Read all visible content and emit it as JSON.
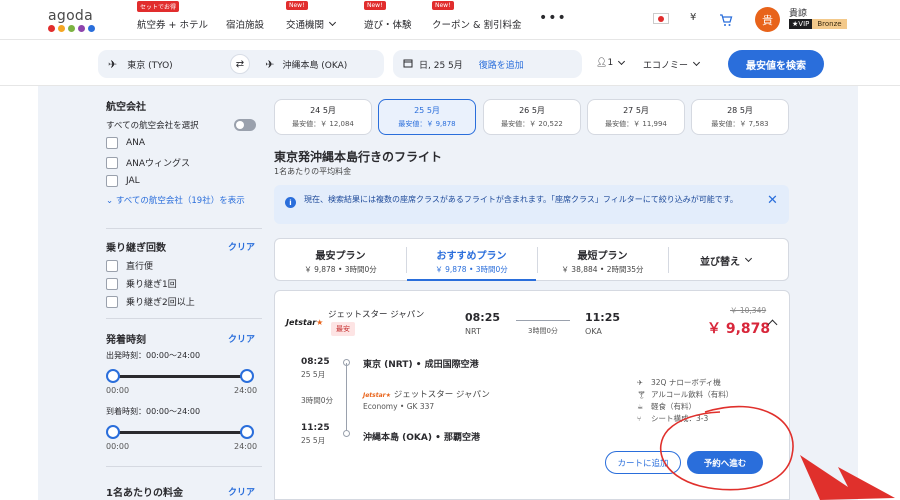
{
  "header": {
    "logo_text": "agoda",
    "nav": [
      {
        "label": "航空券 + ホテル",
        "badge": "セットでお得"
      },
      {
        "label": "宿泊施設",
        "badge": ""
      },
      {
        "label": "交通機関",
        "badge": "New!"
      },
      {
        "label": "遊び・体験",
        "badge": "New!"
      },
      {
        "label": "クーポン & 割引料金",
        "badge": "New!"
      }
    ],
    "more": "•••",
    "currency": "¥",
    "avatar_initial": "貴",
    "user_name": "貴諒",
    "vip_label": "★VIP",
    "vip_tier": "Bronze"
  },
  "search": {
    "origin": "東京 (TYO)",
    "destination": "沖縄本島 (OKA)",
    "date": "日, 25 5月",
    "add_return": "復路を追加",
    "passengers": "1",
    "cabin": "エコノミー",
    "search_button": "最安値を検索"
  },
  "filters": {
    "airline_title": "航空会社",
    "select_all": "すべての航空会社を選択",
    "airlines": [
      "ANA",
      "ANAウィングス",
      "JAL"
    ],
    "show_all": "すべての航空会社（19社）を表示",
    "stops_title": "乗り継ぎ回数",
    "stops_clear": "クリア",
    "stops": [
      "直行便",
      "乗り継ぎ1回",
      "乗り継ぎ2回以上"
    ],
    "times_title": "発着時刻",
    "times_clear": "クリア",
    "departure_label": "出発時刻：00:00〜24:00",
    "arrival_label": "到着時刻：00:00〜24:00",
    "range_min": "00:00",
    "range_max": "24:00",
    "price_title": "1名あたりの料金",
    "price_clear": "クリア"
  },
  "dates": [
    {
      "date": "24 5月",
      "price": "最安値：￥ 12,084"
    },
    {
      "date": "25 5月",
      "price": "最安値：￥ 9,878"
    },
    {
      "date": "26 5月",
      "price": "最安値：￥ 20,522"
    },
    {
      "date": "27 5月",
      "price": "最安値：￥ 11,994"
    },
    {
      "date": "28 5月",
      "price": "最安値：￥ 7,583"
    }
  ],
  "results": {
    "title": "東京発沖縄本島行きのフライト",
    "subtitle": "1名あたりの平均料金",
    "notice": "現在、検索結果には複数の座席クラスがあるフライトが含まれます。「座席クラス」フィルターにて絞り込みが可能です。",
    "sort_tabs": [
      {
        "title": "最安プラン",
        "sub": "￥ 9,878 • 3時間0分"
      },
      {
        "title": "おすすめプラン",
        "sub": "￥ 9,878 • 3時間0分"
      },
      {
        "title": "最短プラン",
        "sub": "￥ 38,884 • 2時間35分"
      }
    ],
    "sort_by": "並び替え"
  },
  "flight": {
    "logo": "Jetstar",
    "airline": "ジェットスター ジャパン",
    "tag": "最安",
    "dep_time": "08:25",
    "dep_code": "NRT",
    "duration": "3時間0分",
    "arr_time": "11:25",
    "arr_code": "OKA",
    "old_price": "￥ 10,349",
    "price": "￥ 9,878",
    "seg_dep_time": "08:25",
    "seg_dep_date": "25 5月",
    "seg_dep_airport": "東京 (NRT) • 成田国際空港",
    "seg_duration": "3時間0分",
    "seg_airline": "ジェットスター ジャパン",
    "seg_class": "Economy • GK 337",
    "seg_arr_time": "11:25",
    "seg_arr_date": "25 5月",
    "seg_arr_airport": "沖縄本島 (OKA) • 那覇空港",
    "amenities": [
      "32Q ナローボディ機",
      "アルコール飲料（有料）",
      "軽食（有料）",
      "シート構成：3-3"
    ],
    "cart_button": "カートに追加",
    "book_button": "予約へ進む"
  },
  "colors": {
    "accent": "#2a6edb",
    "price": "#d8263a",
    "annotation": "#e0302c"
  }
}
